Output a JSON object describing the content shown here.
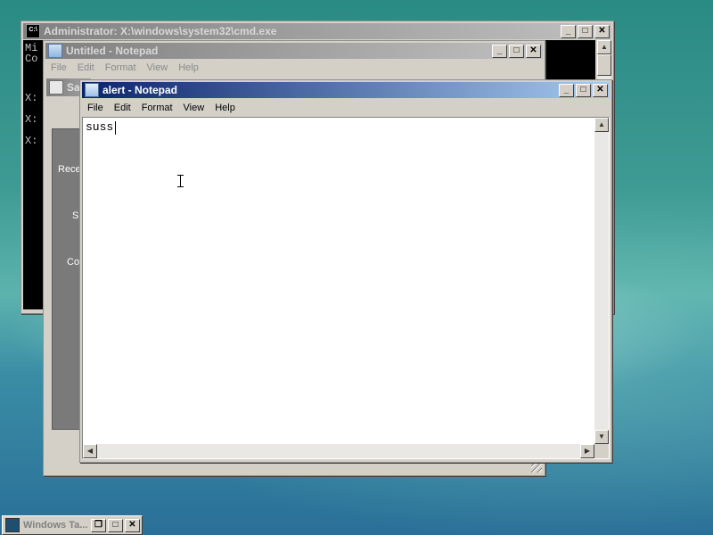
{
  "cmd_window": {
    "title": "Administrator: X:\\windows\\system32\\cmd.exe",
    "lines": [
      "Mi",
      "Co",
      "X:",
      "X:",
      "X:"
    ]
  },
  "untitled_notepad": {
    "title": "Untitled - Notepad",
    "menu": [
      "File",
      "Edit",
      "Format",
      "View",
      "Help"
    ]
  },
  "background_window": {
    "title": "Sa",
    "side_labels": [
      "Rece",
      "S",
      "Co"
    ]
  },
  "alert_notepad": {
    "title": "alert - Notepad",
    "menu": [
      "File",
      "Edit",
      "Format",
      "View",
      "Help"
    ],
    "content": "suss"
  },
  "taskbar": {
    "button_label": "Windows Ta..."
  },
  "controls": {
    "minimize": "_",
    "maximize": "□",
    "close": "✕",
    "restore": "❐"
  }
}
